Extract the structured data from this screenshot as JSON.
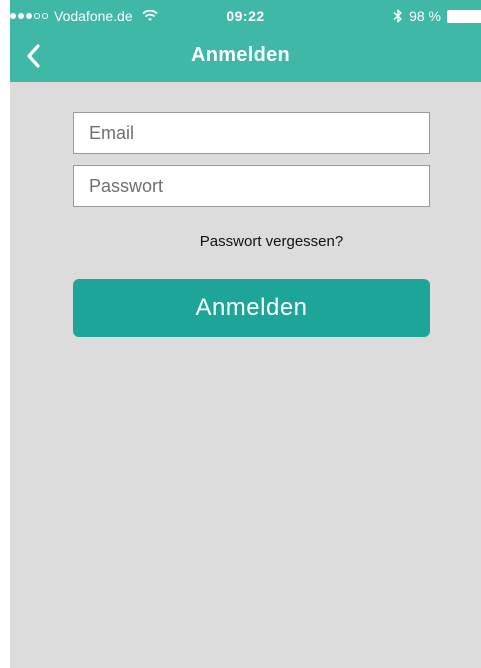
{
  "status_bar": {
    "carrier": "Vodafone.de",
    "time": "09:22",
    "battery": "98 %",
    "signal_full": 3,
    "signal_empty": 2
  },
  "nav": {
    "title": "Anmelden",
    "back_icon": "chevron-left-icon"
  },
  "form": {
    "email_placeholder": "Email",
    "email_value": "",
    "password_placeholder": "Passwort",
    "password_value": "",
    "forgot_label": "Passwort vergessen?",
    "submit_label": "Anmelden"
  },
  "colors": {
    "header": "#3fb8a8",
    "button": "#1ea59a",
    "background": "#dcdcdc"
  }
}
